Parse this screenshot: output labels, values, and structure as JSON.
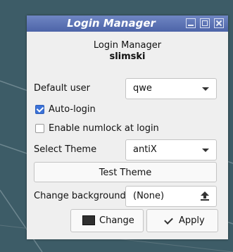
{
  "window": {
    "title": "Login Manager"
  },
  "header": {
    "app_name": "Login Manager",
    "user": "slimski"
  },
  "default_user": {
    "label": "Default user",
    "value": "qwe"
  },
  "auto_login": {
    "label": "Auto-login",
    "checked": true
  },
  "numlock": {
    "label": "Enable numlock at login",
    "checked": false
  },
  "theme": {
    "label": "Select Theme",
    "value": "antiX"
  },
  "test_theme": {
    "label": "Test Theme"
  },
  "background": {
    "label": "Change background",
    "value": "(None)"
  },
  "buttons": {
    "change_label": "Change",
    "apply_label": "Apply"
  },
  "colors": {
    "titlebar": "#5a71b5",
    "checkbox": "#3b72d8",
    "desktop": "#3d5c67"
  },
  "icons": {
    "minimize": "minimize-icon",
    "maximize": "maximize-icon",
    "close": "close-icon",
    "dropdown": "chevron-down-icon",
    "upload": "upload-icon",
    "change": "monitor-icon",
    "apply": "check-icon"
  }
}
